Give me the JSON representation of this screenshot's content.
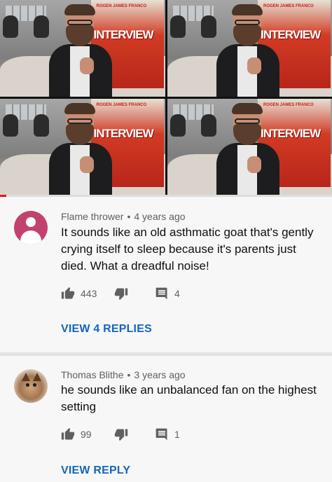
{
  "video": {
    "poster_names": "ROGEN  JAMES FRANCO",
    "poster_title": "INTERVIEW",
    "progress_fraction": 0.02
  },
  "comments": [
    {
      "author": "Flame thrower",
      "age": "4 years ago",
      "text": "It sounds like an old asthmatic goat that's gently crying itself to sleep because it's parents just died. What a dreadful noise!",
      "likes": "443",
      "replies": "4",
      "view_replies_label": "VIEW 4 REPLIES",
      "avatar": "default-user-avatar"
    },
    {
      "author": "Thomas Blithe",
      "age": "3 years ago",
      "text": "he sounds like an unbalanced fan on the highest setting",
      "likes": "99",
      "replies": "1",
      "view_replies_label": "VIEW REPLY",
      "avatar": "cat-photo-avatar"
    }
  ],
  "separator": "•",
  "colors": {
    "link_blue": "#1565c0",
    "avatar_pink": "#c2426f",
    "progress_red": "#e01a1a"
  }
}
